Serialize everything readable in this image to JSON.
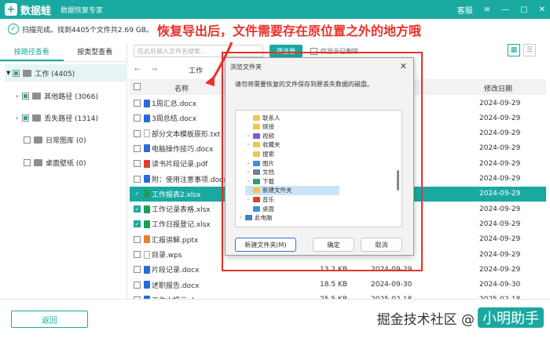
{
  "app": {
    "logo_glyph": "+",
    "name": "数据蛙",
    "subtitle": "数据恢复专家",
    "support": "客服",
    "controls": [
      "≡",
      "—",
      "□",
      "✕"
    ]
  },
  "scan": {
    "status": "扫描完成。找到4405个文件共2.69 GB。"
  },
  "annotation": "恢复导出后，文件需要存在原位置之外的地方哦",
  "sidebar": {
    "tabs": [
      "按路径查看",
      "按类型查看"
    ],
    "tree": [
      {
        "label": "工作 (4405)",
        "state": "partial",
        "icon": "folder-gray"
      },
      {
        "label": "其他路径 (3066)",
        "state": "partial",
        "icon": "folder-gray"
      },
      {
        "label": "丢失路径 (1314)",
        "state": "partial",
        "icon": "folder-gray"
      },
      {
        "label": "日常图库 (0)",
        "state": "none",
        "icon": "folder-gray"
      },
      {
        "label": "桌面壁纸 (0)",
        "state": "none",
        "icon": "folder-gray"
      }
    ]
  },
  "toolbar": {
    "search_placeholder": "在此处输入文件名搜索...",
    "filter_label": "筛选器",
    "show_deleted_label": "仅显示已删除"
  },
  "nav": {
    "back": "←",
    "forward": "→",
    "path": "工作"
  },
  "table": {
    "headers": {
      "name": "名称",
      "modified": "修改日期"
    },
    "rows": [
      {
        "name": "1周汇总.docx",
        "size": "",
        "date1": "",
        "date2": "2024-09-29",
        "icon": "word",
        "checked": false
      },
      {
        "name": "3周总结.docx",
        "size": "",
        "date1": "",
        "date2": "2024-09-29",
        "icon": "word",
        "checked": false
      },
      {
        "name": "部分文本模板原形.txt",
        "size": "",
        "date1": "",
        "date2": "2024-09-29",
        "icon": "txt",
        "checked": false
      },
      {
        "name": "电脑操作技巧.docx",
        "size": "",
        "date1": "",
        "date2": "2024-09-29",
        "icon": "word",
        "checked": false
      },
      {
        "name": "读书片段记录.pdf",
        "size": "",
        "date1": "",
        "date2": "2024-09-29",
        "icon": "pdf",
        "checked": false
      },
      {
        "name": "附：使用注意事项.docx",
        "size": "",
        "date1": "",
        "date2": "2024-09-29",
        "icon": "word",
        "checked": false
      },
      {
        "name": "工作报表2.xlsx",
        "size": "",
        "date1": "",
        "date2": "2024-09-29",
        "icon": "xls",
        "checked": true,
        "selected": true
      },
      {
        "name": "工作记录表格.xlsx",
        "size": "",
        "date1": "",
        "date2": "2024-09-29",
        "icon": "xls",
        "checked": true
      },
      {
        "name": "工作日报登记.xlsx",
        "size": "",
        "date1": "",
        "date2": "2024-09-29",
        "icon": "xls",
        "checked": true
      },
      {
        "name": "汇报讲解.pptx",
        "size": "",
        "date1": "",
        "date2": "2024-09-29",
        "icon": "ppt",
        "checked": false
      },
      {
        "name": "目录.wps",
        "size": "",
        "date1": "",
        "date2": "2024-09-29",
        "icon": "wps",
        "checked": false
      },
      {
        "name": "片段记录.docx",
        "size": "13.2 KB",
        "date1": "2024-09-29",
        "date2": "2024-09-29",
        "icon": "word",
        "checked": false
      },
      {
        "name": "述职报告.docx",
        "size": "18.5 KB",
        "date1": "2024-09-30",
        "date2": "2024-09-30",
        "icon": "word",
        "checked": false
      },
      {
        "name": "工作小提示.docx",
        "size": "25.5 KB",
        "date1": "2025-02-18",
        "date2": "2025-02-18",
        "icon": "word",
        "checked": false
      }
    ]
  },
  "dialog": {
    "title": "浏览文件夹",
    "close": "✕",
    "description": "请勿将需要恢复的文件保存到原丢失数据的磁盘。",
    "tree": [
      {
        "label": "联系人",
        "indent": 1,
        "color": "#f3c44e",
        "arrow": ""
      },
      {
        "label": "链接",
        "indent": 1,
        "color": "#f3c44e",
        "arrow": ""
      },
      {
        "label": "视频",
        "indent": 1,
        "color": "#7a5cd6",
        "arrow": ">"
      },
      {
        "label": "收藏夹",
        "indent": 1,
        "color": "#f3c44e",
        "arrow": ">"
      },
      {
        "label": "搜索",
        "indent": 1,
        "color": "#f3c44e",
        "arrow": ""
      },
      {
        "label": "图片",
        "indent": 1,
        "color": "#3d8fd9",
        "arrow": ">"
      },
      {
        "label": "文档",
        "indent": 1,
        "color": "#6b7f99",
        "arrow": ">"
      },
      {
        "label": "下载",
        "indent": 1,
        "color": "#2f9f6b",
        "arrow": ">"
      },
      {
        "label": "新建文件夹",
        "indent": 1,
        "color": "#f3c44e",
        "arrow": "",
        "selected": true
      },
      {
        "label": "音乐",
        "indent": 1,
        "color": "#e0412d",
        "arrow": ">"
      },
      {
        "label": "桌面",
        "indent": 1,
        "color": "#3d8fd9",
        "arrow": ""
      },
      {
        "label": "此电脑",
        "indent": 0,
        "color": "#4a7fc0",
        "arrow": ">"
      }
    ],
    "buttons": {
      "new_folder": "新建文件夹(M)",
      "ok": "确定",
      "cancel": "取消"
    }
  },
  "bottom": {
    "back_label": "返回",
    "watermark_text": "掘金技术社区 @",
    "watermark_pill": "小明助手"
  },
  "colors": {
    "accent": "#1aa9a0",
    "annotation": "#e8322a"
  }
}
